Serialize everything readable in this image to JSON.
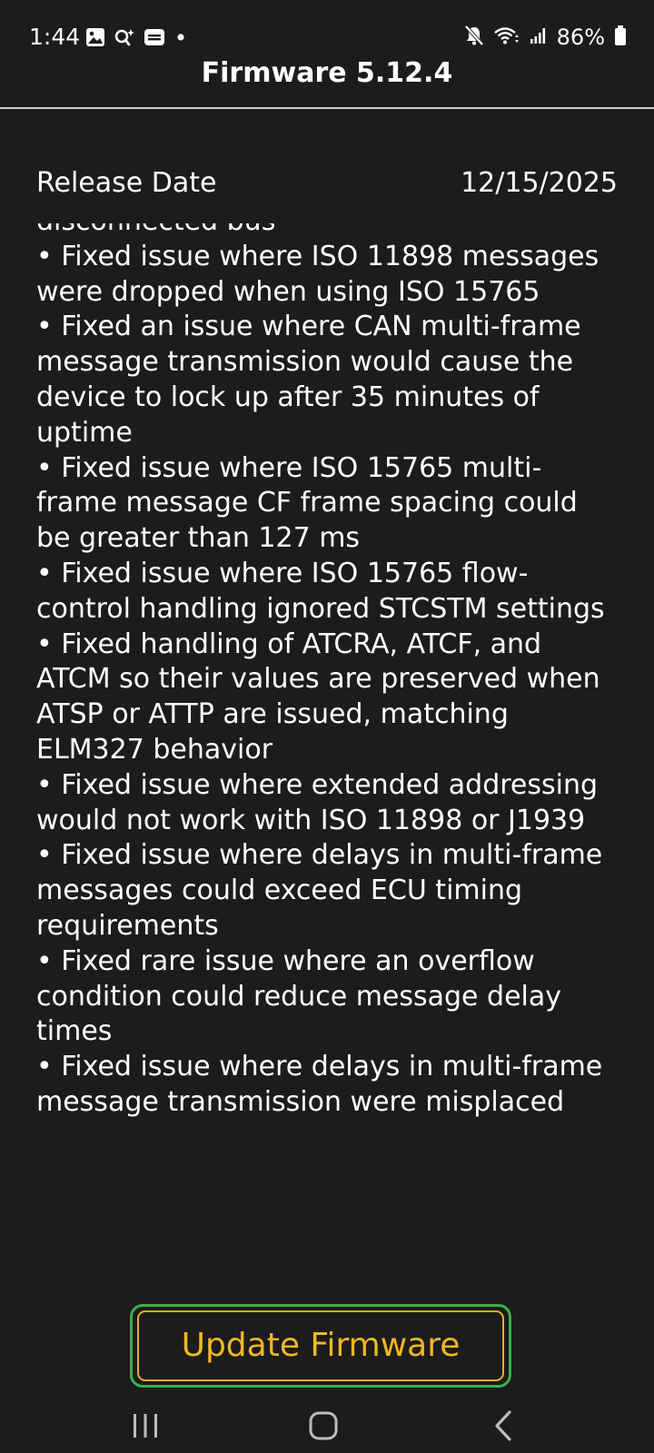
{
  "status_bar": {
    "time": "1:44",
    "battery_percent": "86%",
    "left_icons": [
      "gallery-icon",
      "assistant-icon",
      "message-icon",
      "notification-dot-icon"
    ],
    "right_icons": [
      "mute-icon",
      "wifi-icon",
      "signal-icon",
      "battery-icon"
    ]
  },
  "header": {
    "title": "Firmware 5.12.4"
  },
  "release": {
    "label": "Release Date",
    "value": "12/15/2025"
  },
  "release_notes": {
    "text": "disconnected bus\n• Fixed issue where ISO 11898 messages were dropped when using ISO 15765\n• Fixed an issue where CAN multi-frame message transmission would cause the device to lock up after 35 minutes of uptime\n• Fixed issue where ISO 15765 multi-frame message CF frame spacing could be greater than 127 ms\n• Fixed issue where ISO 15765 flow-control handling ignored STCSTM settings\n• Fixed handling of ATCRA, ATCF, and ATCM so their values are preserved when ATSP or ATTP are issued, matching ELM327 behavior\n• Fixed issue where extended addressing would not work with ISO 11898 or J1939\n• Fixed issue where delays in multi-frame messages could exceed ECU timing requirements\n• Fixed rare issue where an overflow condition could reduce message delay times\n• Fixed issue where delays in multi-frame message transmission were misplaced"
  },
  "actions": {
    "update_label": "Update Firmware"
  },
  "nav_bar": {
    "items": [
      "recent-apps-icon",
      "home-icon",
      "back-icon"
    ]
  },
  "colors": {
    "background": "#1c1c1c",
    "text": "#ffffff",
    "divider": "#d0d0d0",
    "button_text": "#f1b724",
    "button_border": "#e8b21c",
    "focus_ring": "#3fae4a"
  }
}
